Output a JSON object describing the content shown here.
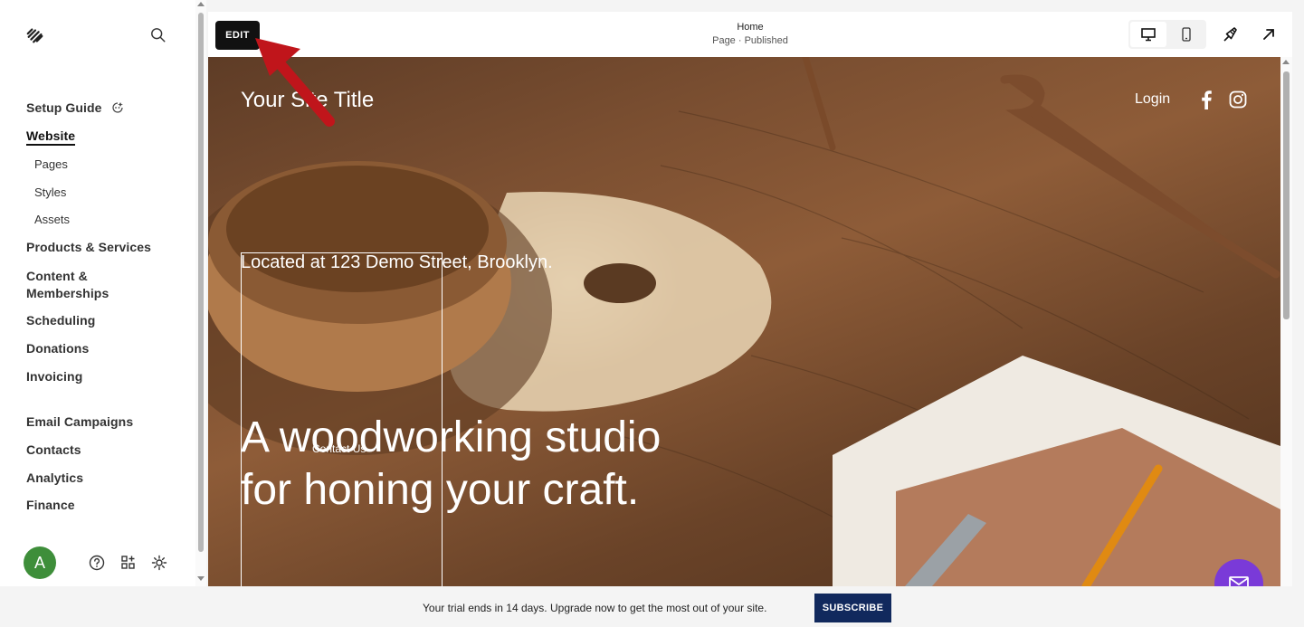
{
  "sidebar": {
    "logo_icon": "squarespace-logo-icon",
    "search_icon": "search-icon",
    "setup_guide": "Setup Guide",
    "website": "Website",
    "website_subitems": [
      "Pages",
      "Styles",
      "Assets"
    ],
    "products_services": "Products & Services",
    "content_memberships_line1": "Content &",
    "content_memberships_line2": "Memberships",
    "scheduling": "Scheduling",
    "donations": "Donations",
    "invoicing": "Invoicing",
    "email_campaigns": "Email Campaigns",
    "contacts": "Contacts",
    "analytics": "Analytics",
    "finance": "Finance",
    "avatar_initial": "A",
    "footer_icons": [
      "help-icon",
      "apps-icon",
      "settings-icon"
    ]
  },
  "topbar": {
    "edit_label": "EDIT",
    "page_title": "Home",
    "page_status": "Page · Published",
    "device_icons": [
      "desktop-icon",
      "mobile-icon"
    ],
    "action_icons": [
      "paintbrush-icon",
      "open-external-icon"
    ]
  },
  "preview": {
    "site_title": "Your Site Title",
    "login": "Login",
    "social_icons": [
      "facebook-icon",
      "instagram-icon"
    ],
    "located": "Located at 123 Demo Street, Brooklyn.",
    "headline_line1": "A woodworking studio",
    "headline_line2": "for honing your craft.",
    "contact_us": "Contact Us",
    "chat_icon": "mail-icon"
  },
  "banner": {
    "text": "Your trial ends in 14 days. Upgrade now to get the most out of your site.",
    "subscribe": "SUBSCRIBE"
  },
  "colors": {
    "edit_bg": "#111111",
    "subscribe_bg": "#11295d",
    "avatar_bg": "#3e8e3a",
    "chat_bg": "#7a3ad8",
    "annotation_arrow": "#c0151b"
  }
}
